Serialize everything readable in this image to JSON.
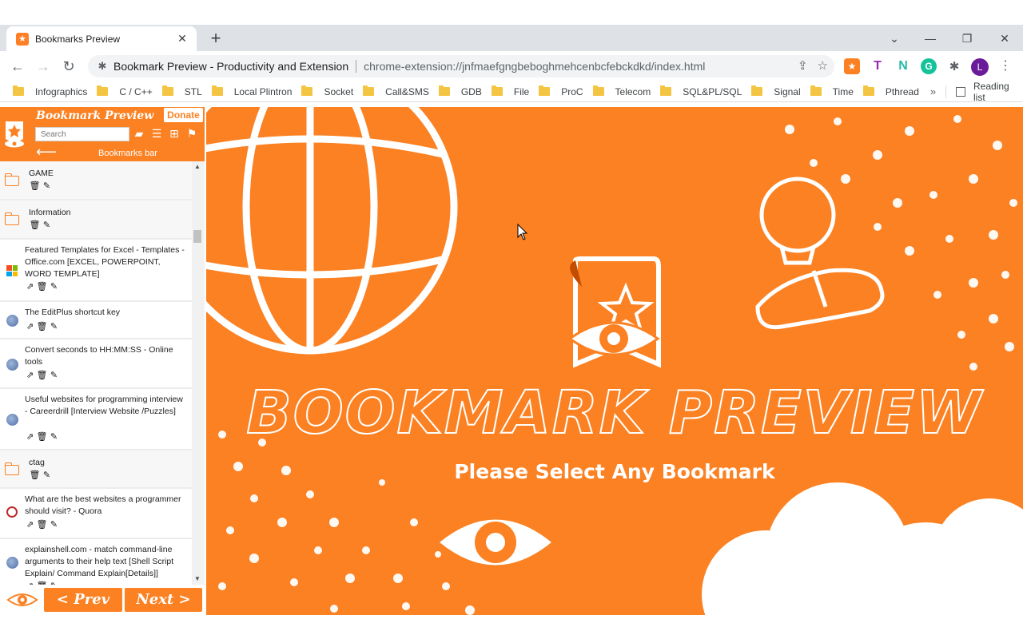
{
  "browser": {
    "tab_title": "Bookmarks Preview",
    "omnibox_site": "Bookmark Preview - Productivity and Extension",
    "omnibox_url": "chrome-extension://jnfmaefgngbeboghmehcenbcfebckdkd/index.html",
    "profile_initial": "L"
  },
  "bookmarks_bar": {
    "items": [
      "Infographics",
      "C / C++",
      "STL",
      "Local Plintron",
      "Socket",
      "Call&SMS",
      "GDB",
      "File",
      "ProC",
      "Telecom",
      "SQL&PL/SQL",
      "Signal",
      "Time",
      "Pthread"
    ],
    "more": "»",
    "reading_list": "Reading list"
  },
  "sidebar": {
    "title": "Bookmark Preview",
    "donate": "Donate",
    "search_placeholder": "Search",
    "current_folder": "Bookmarks bar",
    "items": [
      {
        "type": "folder",
        "title": "GAME"
      },
      {
        "type": "folder",
        "title": "Information"
      },
      {
        "type": "link",
        "icon": "microsoft-icon",
        "title": "Featured Templates for Excel - Templates - Office.com [EXCEL, POWERPOINT, WORD TEMPLATE]"
      },
      {
        "type": "link",
        "icon": "globe-icon",
        "title": "The EditPlus shortcut key"
      },
      {
        "type": "link",
        "icon": "globe-icon",
        "title": "Convert seconds to HH:MM:SS - Online tools"
      },
      {
        "type": "link",
        "icon": "globe-icon",
        "title": "Useful websites for programming interview - Careerdrill [Interview Website /Puzzles]"
      },
      {
        "type": "folder",
        "title": "ctag"
      },
      {
        "type": "link",
        "icon": "quora-icon",
        "title": "What are the best websites a programmer should visit? - Quora"
      },
      {
        "type": "link",
        "icon": "globe-icon",
        "title": "explainshell.com - match command-line arguments to their help text [Shell Script Explain/ Command Explain[Details]]"
      }
    ],
    "prev": "< Prev",
    "next": "Next >"
  },
  "main": {
    "title": "BOOKMARK PREVIEW",
    "subtitle": "Please Select Any Bookmark"
  },
  "colors": {
    "brand_orange": "#fb8122",
    "white": "#ffffff"
  }
}
